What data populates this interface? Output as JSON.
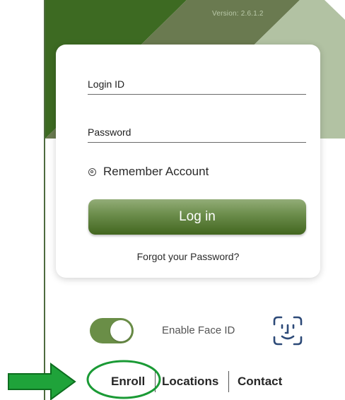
{
  "app": {
    "version_text": "Version: 2.6.1.2"
  },
  "login_card": {
    "login_id_placeholder": "Login ID",
    "password_placeholder": "Password",
    "remember_label": "Remember Account",
    "login_button_label": "Log in",
    "forgot_password_label": "Forgot your Password?"
  },
  "face_id": {
    "label": "Enable Face ID",
    "enabled": true,
    "icon": "face-id-icon"
  },
  "footer_links": {
    "enroll": "Enroll",
    "locations": "Locations",
    "contact": "Contact"
  },
  "annotation": {
    "arrow_color": "#1fa33a",
    "ellipse_color": "#1a9a35"
  },
  "colors": {
    "brand_dark_green": "#3d6a22",
    "brand_olive": "#6a7a50",
    "brand_sage": "#b2c2a3",
    "button_green": "#5f8140",
    "toggle_green": "#6a8e47"
  }
}
